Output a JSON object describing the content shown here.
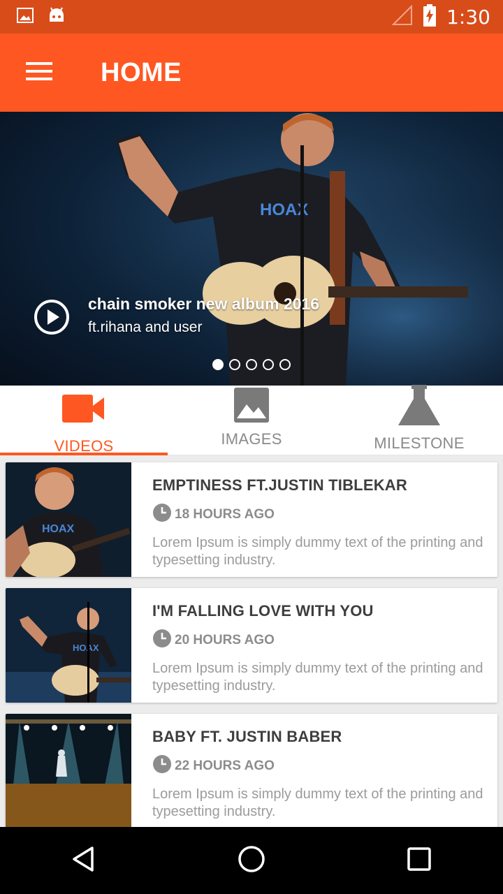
{
  "status_bar": {
    "time": "1:30",
    "icons": [
      "image-notification-icon",
      "android-icon",
      "signal-icon",
      "battery-charging-icon"
    ]
  },
  "app_bar": {
    "title": "HOME",
    "menu_icon": "hamburger-menu-icon"
  },
  "banner": {
    "title": "chain smoker new album 2016",
    "subtitle": "ft.rihana and user",
    "play_icon": "play-circle-icon",
    "slide_count": 5,
    "active_slide": 1
  },
  "tabs": [
    {
      "label": "VIDEOS",
      "icon": "videocam-icon",
      "active": true
    },
    {
      "label": "IMAGES",
      "icon": "image-icon",
      "active": false
    },
    {
      "label": "MILESTONE",
      "icon": "flask-icon",
      "active": false
    }
  ],
  "items": [
    {
      "title": "EMPTINESS FT.JUSTIN TIBLEKAR",
      "time": "18 HOURS AGO",
      "desc": "Lorem Ipsum is simply dummy text of the printing and typesetting industry."
    },
    {
      "title": "I'M FALLING LOVE WITH YOU",
      "time": "20 HOURS AGO",
      "desc": "Lorem Ipsum is simply dummy text of the printing and typesetting industry."
    },
    {
      "title": "BABY FT. JUSTIN BABER",
      "time": "22 HOURS AGO",
      "desc": "Lorem Ipsum is simply dummy text of the printing and typesetting industry."
    }
  ],
  "nav": {
    "back_icon": "back-triangle-icon",
    "home_icon": "home-circle-icon",
    "recents_icon": "recents-square-icon"
  },
  "colors": {
    "primary": "#ff5722",
    "primary_dark": "#d84c1a",
    "text_title": "#3e3e3e",
    "text_muted": "#9b9b9b"
  }
}
